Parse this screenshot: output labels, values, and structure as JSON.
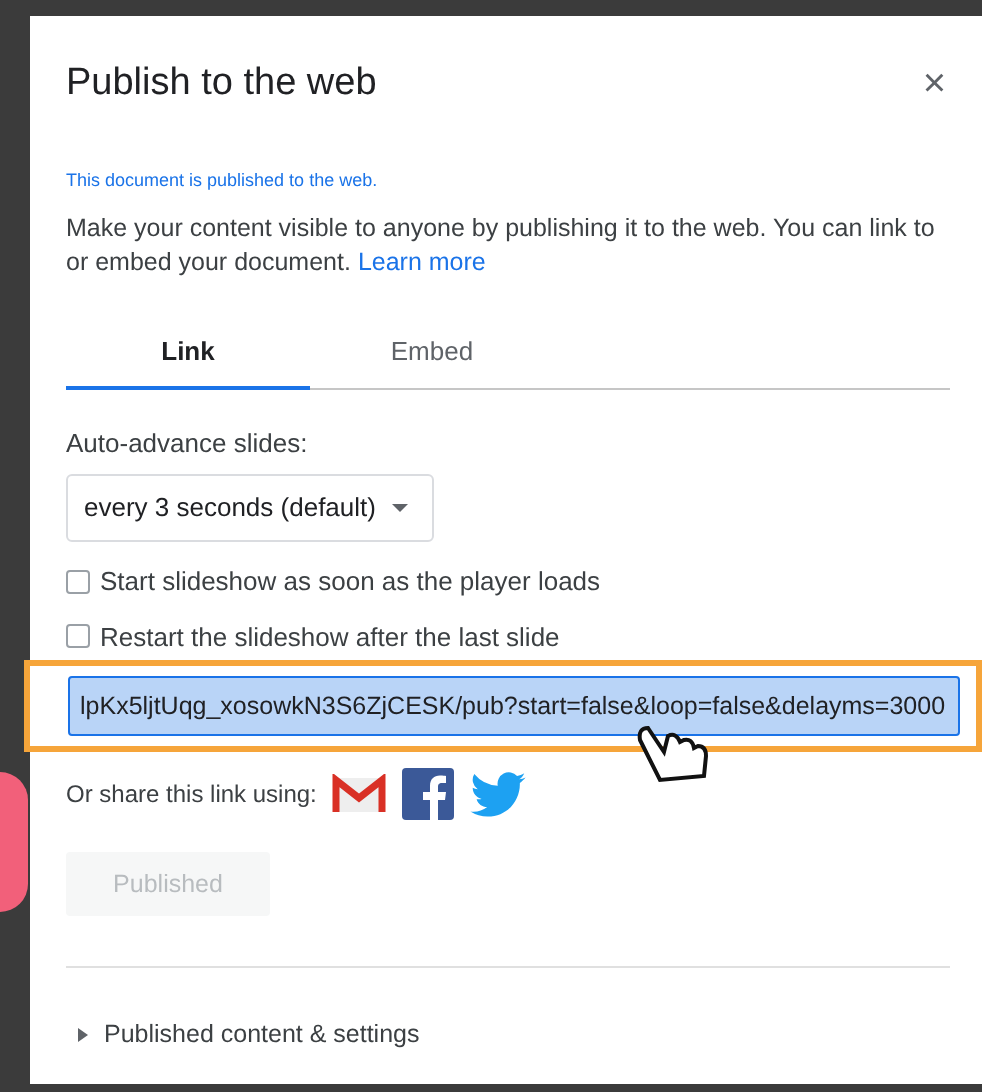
{
  "dialog": {
    "title": "Publish to the web",
    "close": "×"
  },
  "status": "This document is published to the web.",
  "description": {
    "text": "Make your content visible to anyone by publishing it to the web. You can link to or embed your document.",
    "link": "Learn more"
  },
  "tabs": [
    {
      "label": "Link",
      "selected": true
    },
    {
      "label": "Embed",
      "selected": false
    }
  ],
  "auto_advance": {
    "label": "Auto-advance slides:",
    "value": "every 3 seconds (default)"
  },
  "options": [
    {
      "label": "Start slideshow as soon as the player loads",
      "checked": false
    },
    {
      "label": "Restart the slideshow after the last slide",
      "checked": false
    }
  ],
  "link_field": {
    "value": "lpKx5ljtUqg_xosowkN3S6ZjCESK/pub?start=false&loop=false&delayms=3000",
    "highlighted": true
  },
  "share": {
    "label": "Or share this link using:"
  },
  "publish_button": {
    "label": "Published",
    "disabled": true
  },
  "settings": {
    "label": "Published content & settings",
    "expanded": false
  }
}
